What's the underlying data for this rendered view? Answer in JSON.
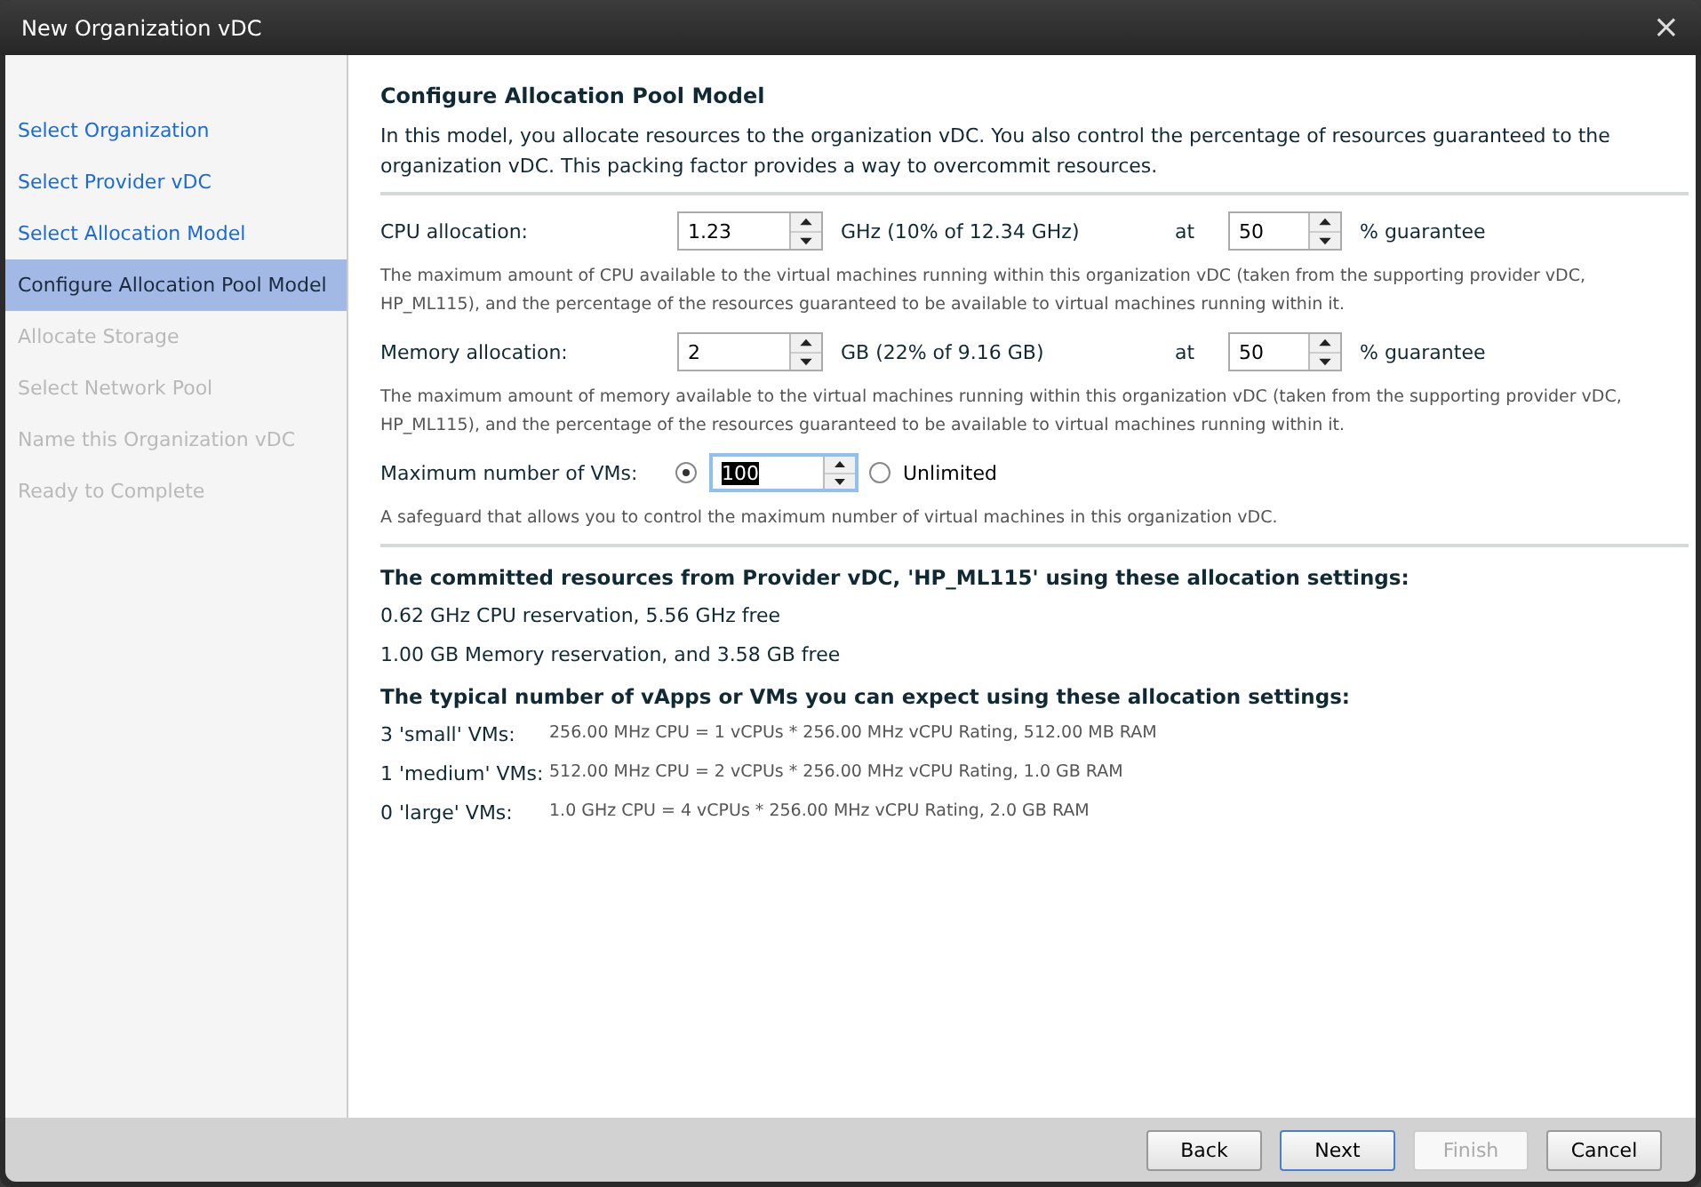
{
  "window": {
    "title": "New Organization vDC",
    "close": "×"
  },
  "steps": [
    {
      "label": "Select Organization",
      "selected": false,
      "disabled": false
    },
    {
      "label": "Select Provider vDC",
      "selected": false,
      "disabled": false
    },
    {
      "label": "Select Allocation Model",
      "selected": false,
      "disabled": false
    },
    {
      "label": "Configure Allocation Pool Model",
      "selected": true,
      "disabled": false
    },
    {
      "label": "Allocate Storage",
      "selected": false,
      "disabled": true
    },
    {
      "label": "Select Network Pool",
      "selected": false,
      "disabled": true
    },
    {
      "label": "Name this Organization vDC",
      "selected": false,
      "disabled": true
    },
    {
      "label": "Ready to Complete",
      "selected": false,
      "disabled": true
    }
  ],
  "heading": "Configure Allocation Pool Model",
  "intro": "In this model, you allocate resources to the organization vDC. You also control the percentage of resources guaranteed to the organization vDC. This packing factor provides a way to overcommit resources.",
  "allocations": [
    {
      "label": "CPU allocation:",
      "value": "1.23",
      "unit": "GHz (10% of 12.34 GHz)",
      "at": "at",
      "guarantee": "50",
      "guarantee_label": "% guarantee",
      "help": "The maximum amount of CPU available to the virtual machines running within this organization vDC (taken from the supporting provider vDC, HP_ML115), and the percentage of the resources guaranteed to be available to virtual machines running within it."
    },
    {
      "label": "Memory allocation:",
      "value": "2",
      "unit": "GB (22% of 9.16 GB)",
      "at": "at",
      "guarantee": "50",
      "guarantee_label": "% guarantee",
      "help": "The maximum amount of memory available to the virtual machines running within this organization vDC (taken from the supporting provider vDC, HP_ML115), and the percentage of the resources guaranteed to be available to virtual machines running within it."
    }
  ],
  "max_vms": {
    "label": "Maximum number of VMs:",
    "limited_selected": true,
    "value": "100",
    "unlimited_label": "Unlimited",
    "unlimited_selected": false,
    "help": "A safeguard that allows you to control the maximum number of virtual machines in this organization vDC."
  },
  "committed": {
    "heading": "The committed resources from Provider vDC, 'HP_ML115' using these allocation settings:",
    "lines": [
      "0.62 GHz CPU reservation, 5.56 GHz free",
      "1.00 GB Memory reservation, and 3.58 GB free"
    ]
  },
  "typical": {
    "heading": "The typical number of vApps or VMs you can expect using these allocation settings:",
    "rows": [
      {
        "label": "3 'small' VMs:",
        "detail": "256.00 MHz CPU = 1 vCPUs * 256.00 MHz vCPU Rating, 512.00 MB RAM"
      },
      {
        "label": "1 'medium' VMs:",
        "detail": "512.00 MHz CPU = 2 vCPUs * 256.00 MHz vCPU Rating, 1.0 GB RAM"
      },
      {
        "label": "0 'large' VMs:",
        "detail": "1.0 GHz CPU = 4 vCPUs * 256.00 MHz vCPU Rating, 2.0 GB RAM"
      }
    ]
  },
  "buttons": [
    {
      "label": "Back",
      "default": false,
      "disabled": false
    },
    {
      "label": "Next",
      "default": true,
      "disabled": false
    },
    {
      "label": "Finish",
      "default": false,
      "disabled": true
    },
    {
      "label": "Cancel",
      "default": false,
      "disabled": false
    }
  ]
}
